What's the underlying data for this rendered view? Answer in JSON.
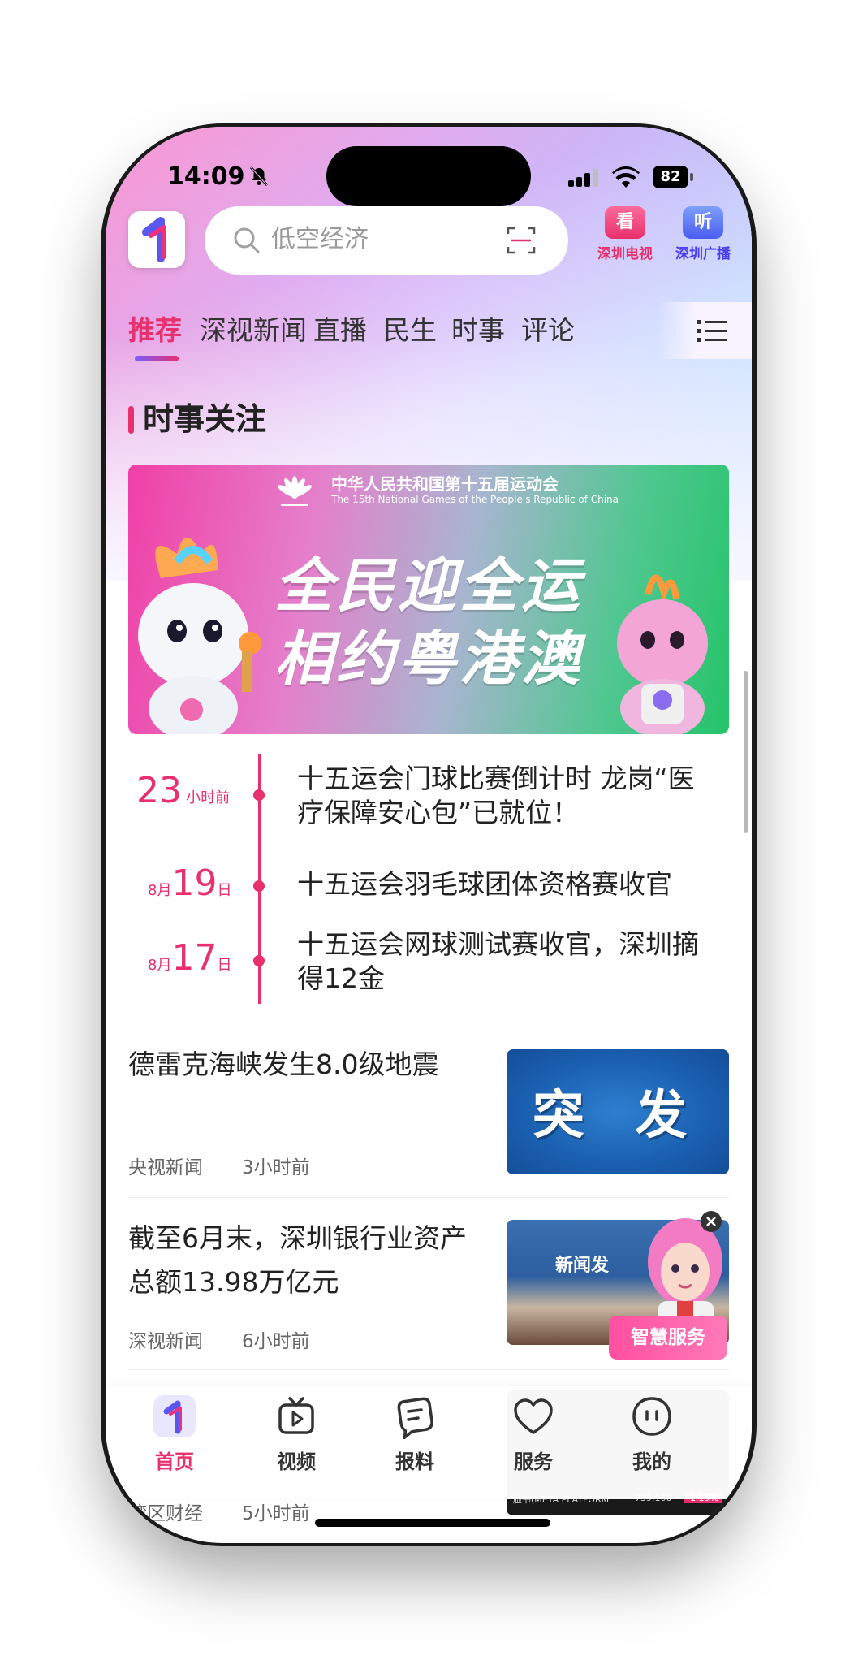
{
  "status_bar": {
    "time": "14:09",
    "battery": "82"
  },
  "header": {
    "search_placeholder": "低空经济",
    "tv": {
      "badge": "看",
      "label": "深圳电视"
    },
    "radio": {
      "badge": "听",
      "label": "深圳广播"
    }
  },
  "tabs": [
    "推荐",
    "深视新闻",
    "直播",
    "民生",
    "时事",
    "评论"
  ],
  "section": {
    "title": "时事关注",
    "banner": {
      "org_cn": "中华人民共和国第十五届运动会",
      "org_en": "The 15th National Games of the People's Republic of China",
      "line1": "全民迎全运",
      "line2": "相约粤港澳"
    },
    "timeline": [
      {
        "big": "23",
        "suffix": "小时前",
        "text": "十五运会门球比赛倒计时 龙岗“医疗保障安心包”已就位！"
      },
      {
        "prefix": "8月",
        "big": "19",
        "suffix": "日",
        "text": "十五运会羽毛球团体资格赛收官"
      },
      {
        "prefix": "8月",
        "big": "17",
        "suffix": "日",
        "text": "十五运会网球测试赛收官，深圳摘得12金"
      }
    ]
  },
  "news": [
    {
      "title": "德雷克海峡发生8.0级地震",
      "source": "央视新闻",
      "time": "3小时前",
      "thumb_text": "突 发"
    },
    {
      "title": "截至6月末，深圳银行业资产总额13.98万亿元",
      "source": "深视新闻",
      "time": "6小时前",
      "thumb_text": "新闻发"
    },
    {
      "title": "",
      "source": "湾区财经",
      "time": "5小时前",
      "stock": {
        "name": "脸书(META PLATFORM",
        "price": "739.100",
        "change": "-1.15%"
      }
    }
  ],
  "smart_service": "智慧服务",
  "bottom_nav": [
    {
      "label": "首页",
      "icon": "home-logo-icon",
      "active": true
    },
    {
      "label": "视频",
      "icon": "video-icon"
    },
    {
      "label": "报料",
      "icon": "report-icon"
    },
    {
      "label": "服务",
      "icon": "heart-icon"
    },
    {
      "label": "我的",
      "icon": "profile-icon"
    }
  ],
  "colors": {
    "accent": "#e8306c",
    "brand_purple": "#7a5cff"
  }
}
